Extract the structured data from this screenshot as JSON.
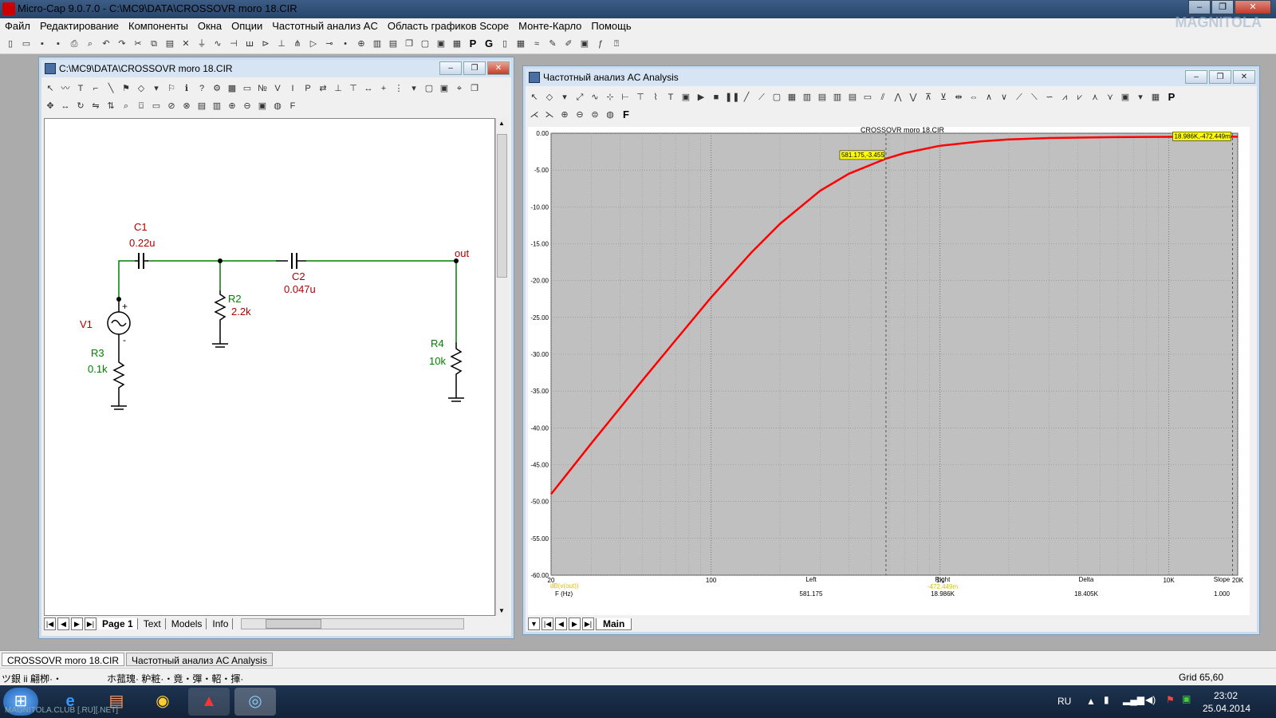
{
  "app": {
    "title": "Micro-Cap 9.0.7.0 - C:\\MC9\\DATA\\CROSSOVR moro 18.CIR"
  },
  "menu": [
    "Файл",
    "Редактирование",
    "Компоненты",
    "Окна",
    "Опции",
    "Частотный анализ AC",
    "Область графиков Scope",
    "Монте-Карло",
    "Помощь"
  ],
  "schematic": {
    "title": "C:\\MC9\\DATA\\CROSSOVR moro 18.CIR",
    "components": {
      "c1_name": "C1",
      "c1_value": "0.22u",
      "c2_name": "C2",
      "c2_value": "0.047u",
      "r2_name": "R2",
      "r2_value": "2.2k",
      "r3_name": "R3",
      "r3_value": "0.1k",
      "r4_name": "R4",
      "r4_value": "10k",
      "v1_name": "V1",
      "out_label": "out",
      "plus": "+",
      "minus": "-"
    },
    "sheet_tabs": [
      "Page 1",
      "Text",
      "Models",
      "Info"
    ]
  },
  "analysis": {
    "title": "Частотный анализ AC Analysis",
    "plot_title": "CROSSOVR moro 18.CIR",
    "cursor_left_label": "581.175,-3.455",
    "cursor_right_label": "18.986K,-472.449m",
    "tab": "Main",
    "readout": {
      "expr_label": "dB(v(out))",
      "x_label": "F (Hz)",
      "left_hdr": "Left",
      "left_val": "581.175",
      "right_hdr": "Right",
      "right_val": "18.986K",
      "right_y": "-472.449m",
      "delta_hdr": "Delta",
      "delta_val": "18.405K",
      "slope_hdr": "Slope",
      "slope_val": "1.000"
    }
  },
  "chart_data": {
    "type": "line",
    "title": "CROSSOVR moro 18.CIR",
    "xlabel": "F (Hz)",
    "ylabel": "dB(v(out))",
    "xscale": "log",
    "xlim": [
      20,
      20000
    ],
    "ylim": [
      -60,
      0
    ],
    "x_ticks": [
      "20",
      "100",
      "1K",
      "10K",
      "20K"
    ],
    "y_ticks": [
      "0.00",
      "-5.00",
      "-10.00",
      "-15.00",
      "-20.00",
      "-25.00",
      "-30.00",
      "-35.00",
      "-40.00",
      "-45.00",
      "-50.00",
      "-55.00",
      "-60.00"
    ],
    "grid": true,
    "series": [
      {
        "color": "#ff0000",
        "x": [
          20,
          30,
          50,
          70,
          100,
          150,
          200,
          300,
          400,
          581,
          700,
          1000,
          1500,
          2000,
          3000,
          5000,
          7000,
          10000,
          15000,
          20000
        ],
        "y": [
          -49,
          -42.1,
          -33.6,
          -28.1,
          -22.3,
          -16.2,
          -12.3,
          -7.8,
          -5.5,
          -3.455,
          -2.7,
          -1.7,
          -1.1,
          -0.85,
          -0.65,
          -0.55,
          -0.51,
          -0.49,
          -0.475,
          -0.472
        ]
      }
    ],
    "cursors": [
      {
        "x": 581.175,
        "y": -3.455
      },
      {
        "x": 18986,
        "y": -0.472449
      }
    ]
  },
  "docbar": [
    "CROSSOVR moro 18.CIR",
    "Частотный анализ AC Analysis"
  ],
  "status": {
    "left": "ツ銀 ii 翩栁·・",
    "mid": "ホ菰瑰· 粐粧·・竟・彈・軺・揮·",
    "right": "Grid 65,60"
  },
  "tray": {
    "lang": "RU",
    "time": "23:02",
    "date": "25.04.2014"
  },
  "watermark": "MAGNITOLA.CLUB [.RU][.NET]"
}
